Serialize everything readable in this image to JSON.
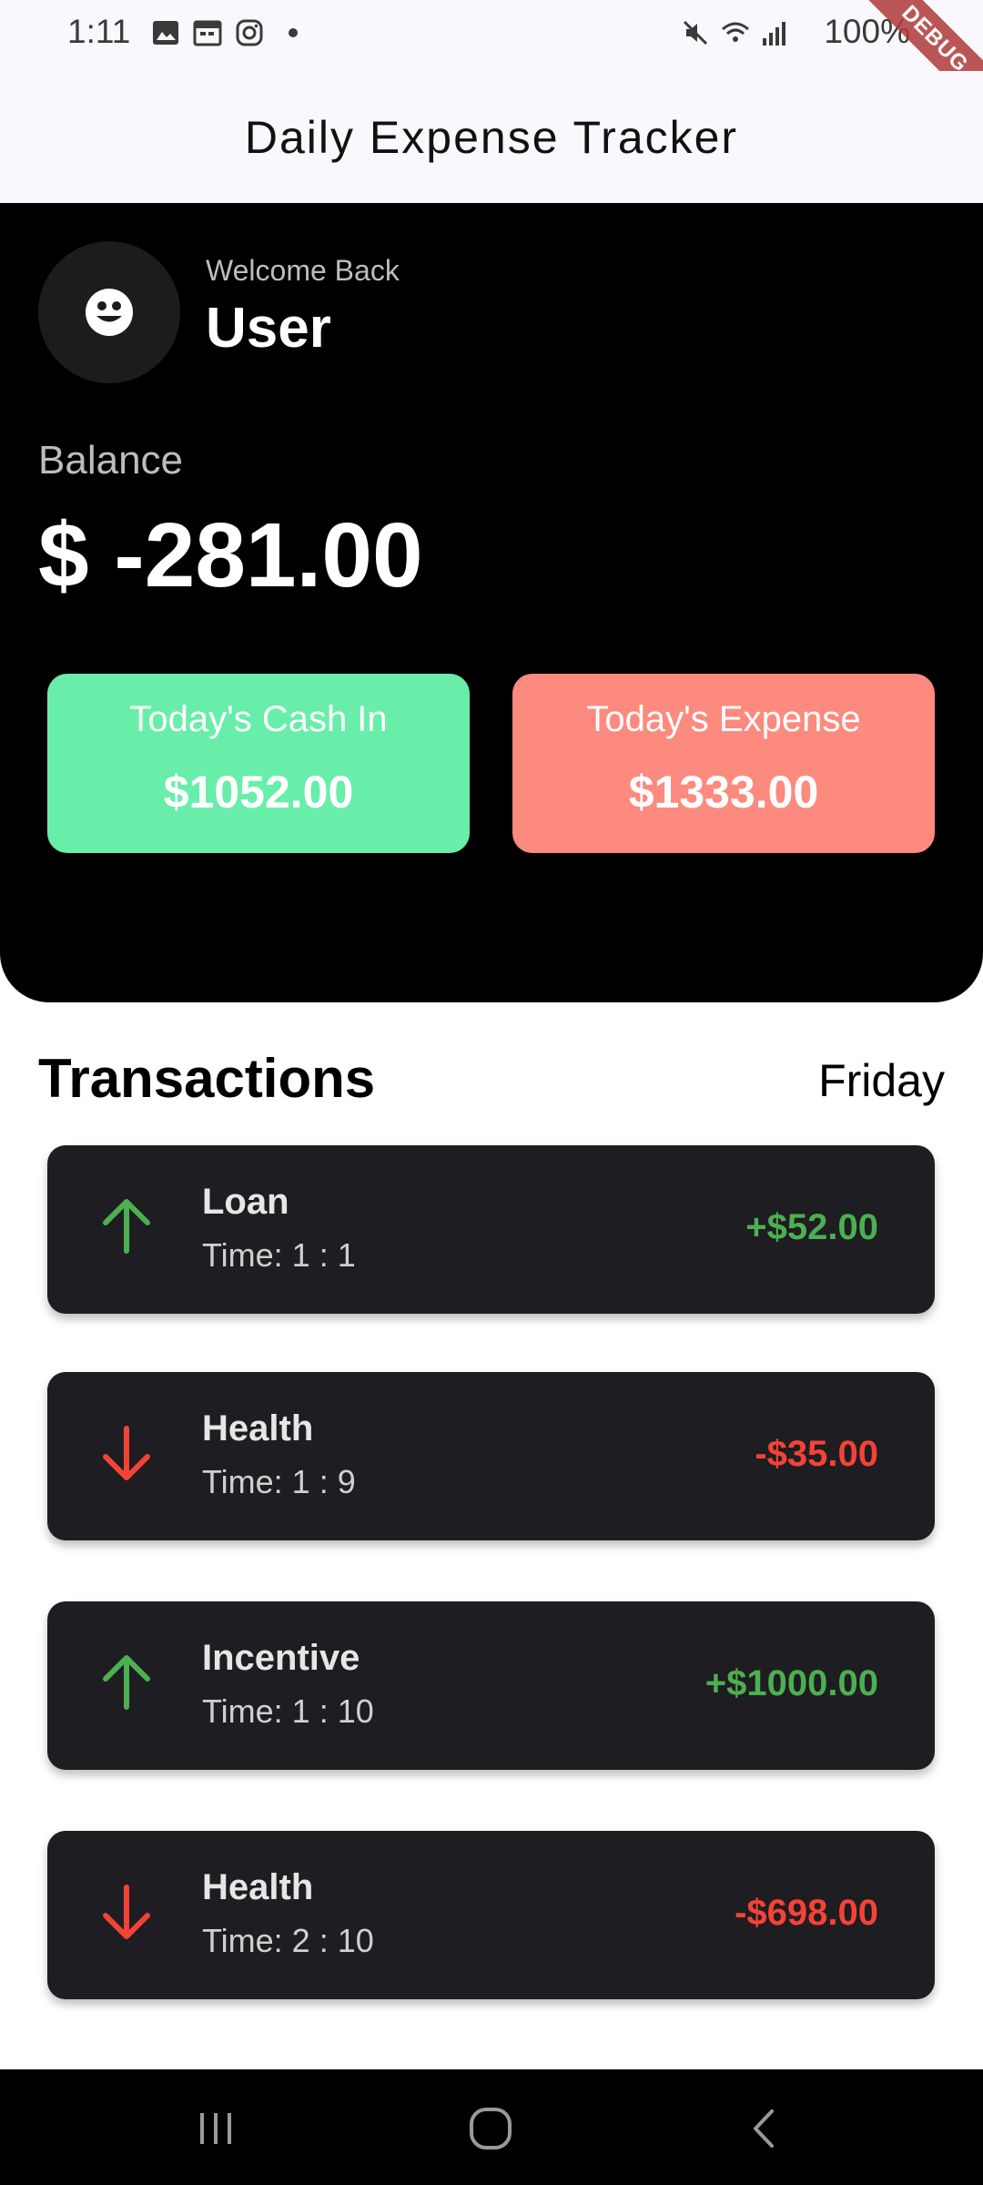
{
  "status_bar": {
    "time": "1:11",
    "battery": "100%",
    "debug_banner": "DEBUG"
  },
  "appbar": {
    "title": "Daily Expense Tracker"
  },
  "header": {
    "welcome": "Welcome Back",
    "username": "User",
    "balance_label": "Balance",
    "balance_amount": "$ -281.00",
    "cash_in": {
      "label": "Today's Cash In",
      "amount": "$1052.00",
      "color": "#69eeaa"
    },
    "expense": {
      "label": "Today's Expense",
      "amount": "$1333.00",
      "color": "#fd8a7e"
    }
  },
  "transactions": {
    "title": "Transactions",
    "day": "Friday",
    "items": [
      {
        "name": "Loan",
        "time": "Time: 1 : 1",
        "amount": "+$52.00",
        "type": "income",
        "icon": "arrow-up-icon"
      },
      {
        "name": "Health",
        "time": "Time: 1 : 9",
        "amount": "-$35.00",
        "type": "expense",
        "icon": "arrow-down-icon"
      },
      {
        "name": "Incentive",
        "time": "Time: 1 : 10",
        "amount": "+$1000.00",
        "type": "income",
        "icon": "arrow-up-icon"
      },
      {
        "name": "Health",
        "time": "Time: 2 : 10",
        "amount": "-$698.00",
        "type": "expense",
        "icon": "arrow-down-icon"
      }
    ]
  },
  "colors": {
    "income": "#4caf50",
    "expense": "#f44336",
    "header_bg": "#000000",
    "card_bg": "#1e1d22"
  }
}
